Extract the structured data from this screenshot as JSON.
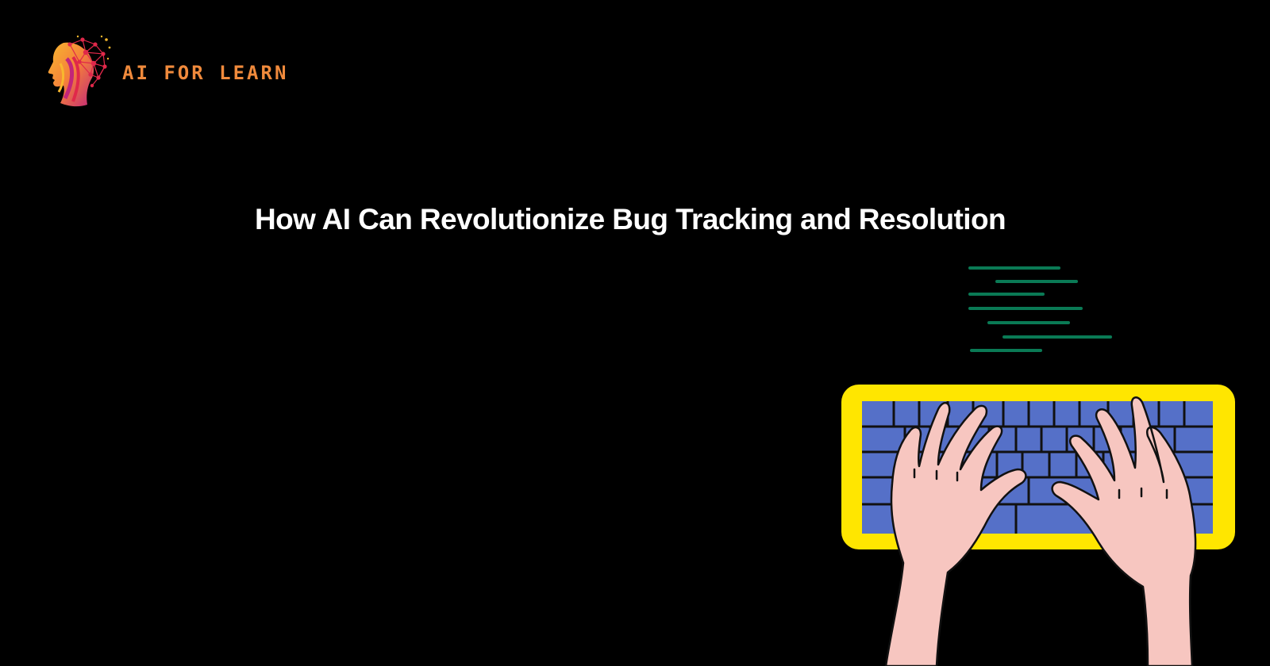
{
  "brand": {
    "name": "AI FOR LEARN",
    "colors": {
      "text": "#f08a3c",
      "mark_red": "#e0284a",
      "mark_orange": "#f47f3b",
      "mark_yellow": "#f8b82e",
      "mark_magenta": "#c2257a"
    },
    "icon": "ai-head-network-icon"
  },
  "hero": {
    "title": "How AI Can Revolutionize Bug Tracking and Resolution"
  },
  "illustration": {
    "icon": "hands-typing-keyboard-illustration",
    "colors": {
      "keyboard_frame": "#ffe600",
      "keys": "#5570c8",
      "hands": "#f7c6c0",
      "code_lines": "#0a7a55"
    }
  }
}
